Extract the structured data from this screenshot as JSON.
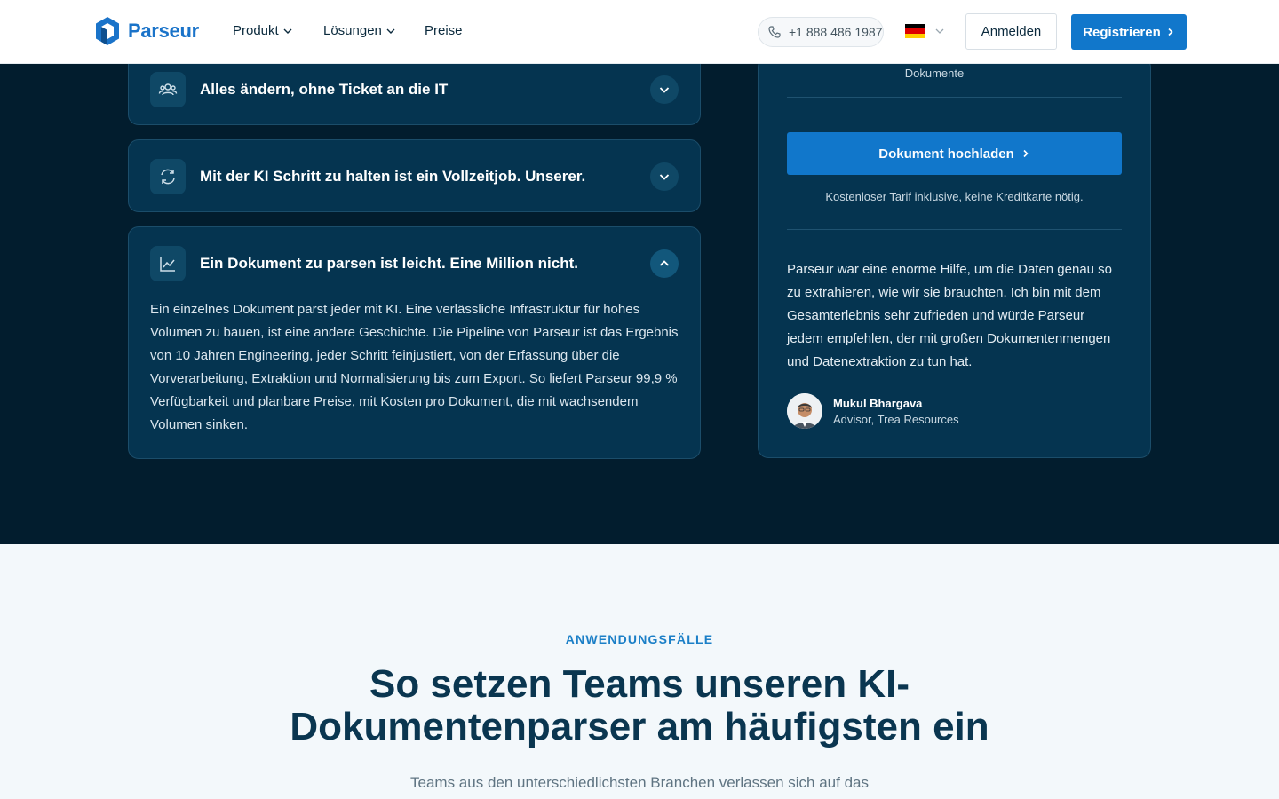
{
  "nav": {
    "logo_text": "Parseur",
    "links": [
      {
        "label": "Produkt"
      },
      {
        "label": "Lösungen"
      },
      {
        "label": "Preise"
      }
    ],
    "phone": "+1 888 486 1987",
    "login_label": "Anmelden",
    "register_label": "Registrieren"
  },
  "accordion": [
    {
      "title": "Alles ändern, ohne Ticket an die IT",
      "icon": "users-icon",
      "open": false
    },
    {
      "title": "Mit der KI Schritt zu halten ist ein Vollzeitjob. Unserer.",
      "icon": "refresh-icon",
      "open": false
    },
    {
      "title": "Ein Dokument zu parsen ist leicht. Eine Million nicht.",
      "icon": "chart-line-icon",
      "open": true,
      "body": "Ein einzelnes Dokument parst jeder mit KI. Eine verlässliche Infrastruktur für hohes Volumen zu bauen, ist eine andere Geschichte. Die Pipeline von Parseur ist das Ergebnis von 10 Jahren Engineering, jeder Schritt feinjustiert, von der Erfassung über die Vorverarbeitung, Extraktion und Normalisierung bis zum Export. So liefert Parseur 99,9 % Verfügbarkeit und planbare Preise, mit Kosten pro Dokument, die mit wachsendem Volumen sinken."
    }
  ],
  "card": {
    "documents_label": "Dokumente",
    "upload_label": "Dokument hochladen",
    "note": "Kostenloser Tarif inklusive, keine Kreditkarte nötig.",
    "quote": "Parseur war eine enorme Hilfe, um die Daten genau so zu extrahieren, wie wir sie brauchten. Ich bin mit dem Gesamterlebnis sehr zufrieden und würde Parseur jedem empfehlen, der mit großen Dokumentenmengen und Datenextraktion zu tun hat.",
    "author_name": "Mukul Bhargava",
    "author_role": "Advisor, Trea Resources"
  },
  "usecases": {
    "eyebrow": "ANWENDUNGSFÄLLE",
    "headline": "So setzen Teams unseren KI-Dokumentenparser am häufigsten ein",
    "subtitle": "Teams aus den unterschiedlichsten Branchen verlassen sich auf das"
  },
  "colors": {
    "brand": "#1177cb",
    "dark_bg": "#021d2e",
    "card_bg": "#053450",
    "light_bg": "#f3f8fb"
  }
}
